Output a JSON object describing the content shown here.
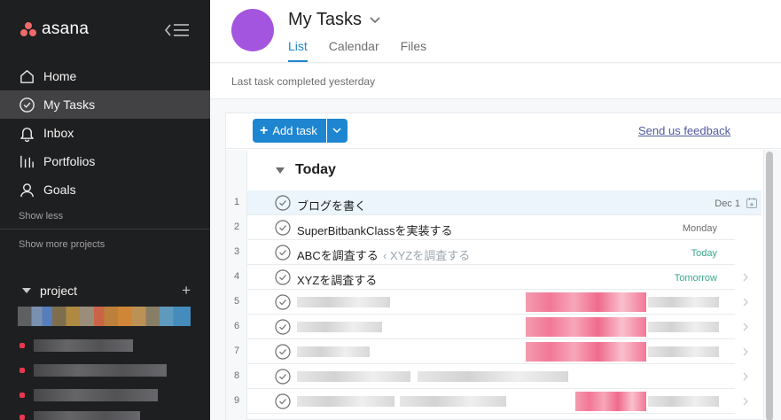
{
  "app": {
    "logo_text": "asana",
    "brand_color": "#f06a6a",
    "accent_color": "#1e86d1"
  },
  "sidebar": {
    "items": [
      {
        "label": "Home",
        "icon": "home-icon"
      },
      {
        "label": "My Tasks",
        "icon": "check-circle-icon",
        "active": true
      },
      {
        "label": "Inbox",
        "icon": "bell-icon"
      },
      {
        "label": "Portfolios",
        "icon": "bar-chart-icon"
      },
      {
        "label": "Goals",
        "icon": "person-icon"
      }
    ],
    "show_less": "Show less",
    "show_more": "Show more projects",
    "project_section": "project"
  },
  "header": {
    "title": "My Tasks",
    "tabs": [
      "List",
      "Calendar",
      "Files"
    ],
    "active_tab": "List"
  },
  "status": "Last task completed yesterday",
  "toolbar": {
    "add_task": "Add task",
    "feedback": "Send us feedback"
  },
  "section": {
    "title": "Today"
  },
  "tasks": [
    {
      "num": "1",
      "name": "ブログを書く",
      "due": "Dec 1",
      "due_color": "default"
    },
    {
      "num": "2",
      "name": "SuperBitbankClassを実装する",
      "due": "Monday",
      "due_color": "default"
    },
    {
      "num": "3",
      "name": "ABCを調査する",
      "parent": "‹ XYZを調査する",
      "due": "Today",
      "due_color": "green"
    },
    {
      "num": "4",
      "name": "XYZを調査する",
      "due": "Tomorrow",
      "due_color": "green"
    },
    {
      "num": "5"
    },
    {
      "num": "6"
    },
    {
      "num": "7"
    },
    {
      "num": "8"
    },
    {
      "num": "9"
    }
  ]
}
